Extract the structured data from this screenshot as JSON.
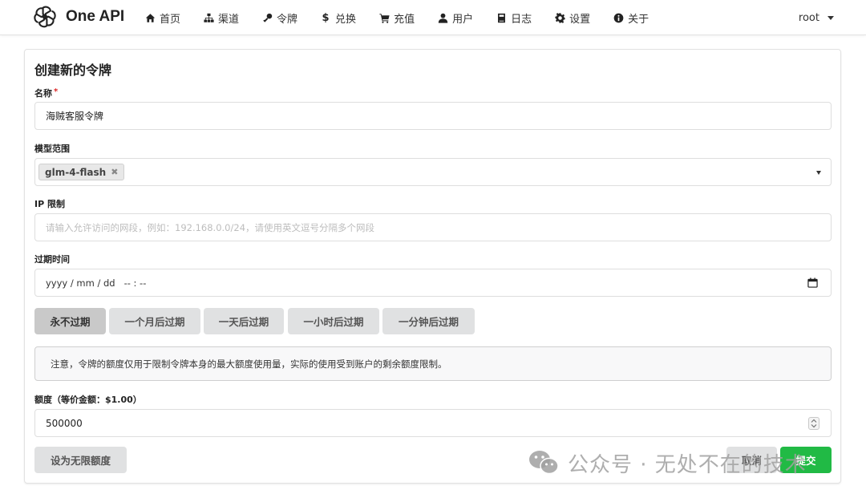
{
  "brand": {
    "name": "One API"
  },
  "nav": [
    {
      "label": "首页",
      "icon": "home-icon"
    },
    {
      "label": "渠道",
      "icon": "sitemap-icon"
    },
    {
      "label": "令牌",
      "icon": "key-icon"
    },
    {
      "label": "兑换",
      "icon": "dollar-icon"
    },
    {
      "label": "充值",
      "icon": "cart-icon"
    },
    {
      "label": "用户",
      "icon": "user-icon"
    },
    {
      "label": "日志",
      "icon": "book-icon"
    },
    {
      "label": "设置",
      "icon": "gear-icon"
    },
    {
      "label": "关于",
      "icon": "info-icon"
    }
  ],
  "user": {
    "name": "root"
  },
  "form": {
    "title": "创建新的令牌",
    "name": {
      "label": "名称",
      "required_mark": "*",
      "value": "海贼客服令牌"
    },
    "models": {
      "label": "模型范围",
      "selected": [
        "glm-4-flash"
      ]
    },
    "ip": {
      "label": "IP 限制",
      "placeholder": "请输入允许访问的网段，例如：192.168.0.0/24，请使用英文逗号分隔多个网段"
    },
    "expire": {
      "label": "过期时间",
      "value": "yyyy / mm / dd   -- : --"
    },
    "expire_buttons": [
      "永不过期",
      "一个月后过期",
      "一天后过期",
      "一小时后过期",
      "一分钟后过期"
    ],
    "notice": "注意，令牌的额度仅用于限制令牌本身的最大额度使用量，实际的使用受到账户的剩余额度限制。",
    "quota": {
      "label": "额度（等价金额：$1.00）",
      "value": "500000"
    },
    "unlimited_button": "设为无限额度",
    "cancel_button": "取消",
    "submit_button": "提交"
  },
  "watermark": {
    "text": "公众号 · 无处不在的技术"
  },
  "colors": {
    "primary_green": "#21ba45",
    "button_grey": "#e0e1e2",
    "active_grey": "#c9c9c9"
  }
}
